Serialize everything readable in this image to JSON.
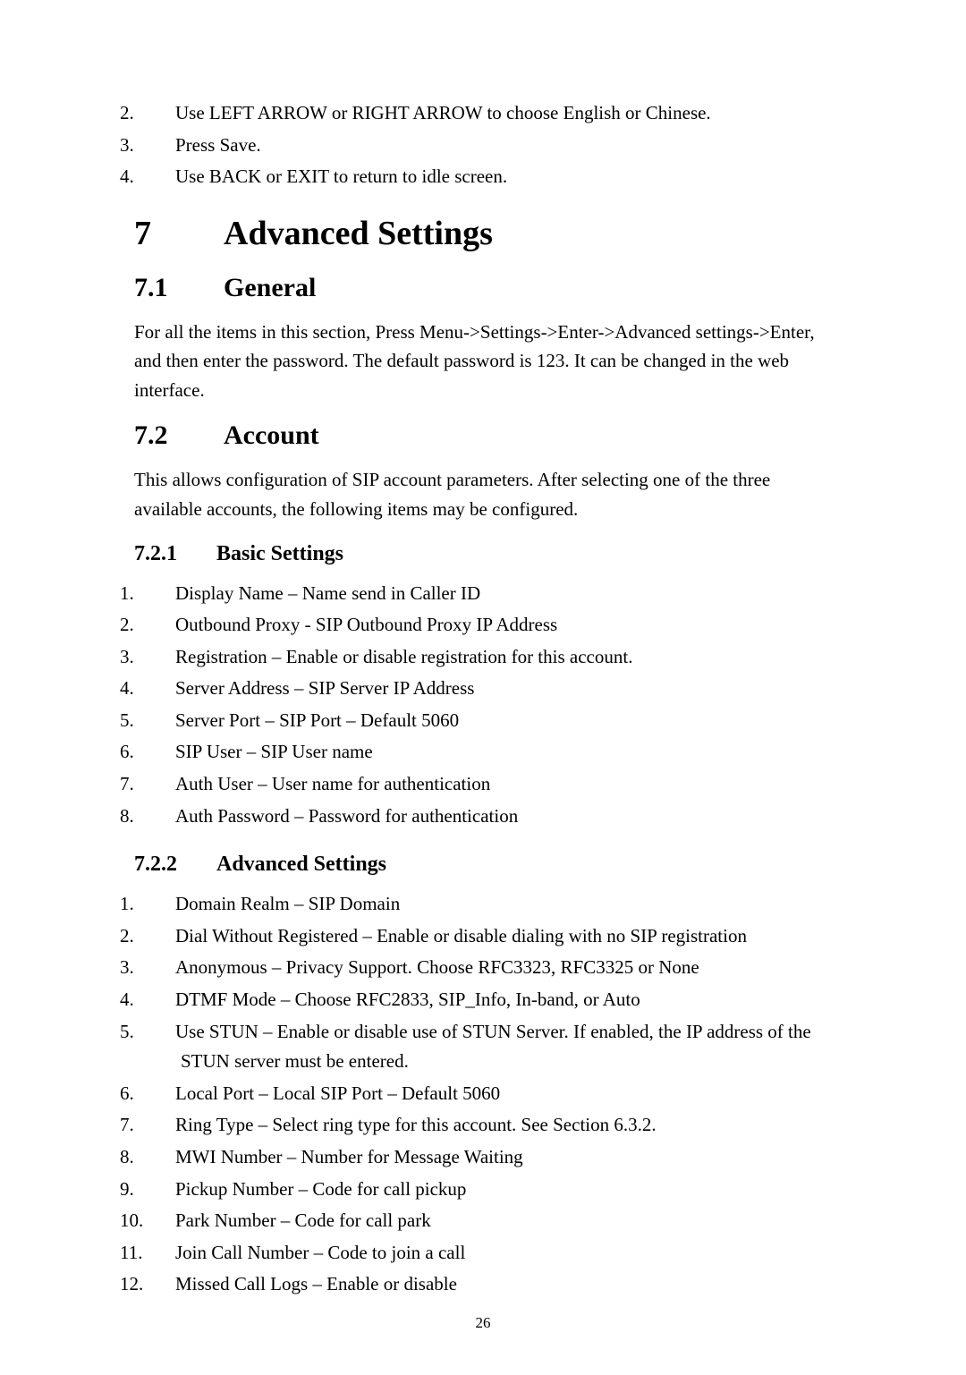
{
  "top_list": {
    "items": [
      {
        "n": "2.",
        "t": "Use LEFT ARROW or RIGHT ARROW to choose English or Chinese."
      },
      {
        "n": "3.",
        "t": "Press Save."
      },
      {
        "n": "4.",
        "t": "Use BACK or EXIT to return to idle screen."
      }
    ]
  },
  "h1": {
    "n": "7",
    "t": "Advanced Settings"
  },
  "s71": {
    "h2": {
      "n": "7.1",
      "t": "General"
    },
    "p": "For all the items in this section, Press Menu->Settings->Enter->Advanced settings->Enter, and then enter the password.    The default password is 123. It can be changed in the web interface."
  },
  "s72": {
    "h2": {
      "n": "7.2",
      "t": "Account"
    },
    "p": "This allows configuration of SIP account parameters.    After selecting one of the three available accounts, the following items may be configured."
  },
  "s721": {
    "h3": {
      "n": "7.2.1",
      "t": "Basic Settings"
    },
    "items": [
      {
        "n": "1.",
        "t": "Display Name – Name send in Caller ID"
      },
      {
        "n": "2.",
        "t": "Outbound Proxy - SIP Outbound Proxy IP Address"
      },
      {
        "n": "3.",
        "t": "Registration – Enable or disable registration for this account."
      },
      {
        "n": "4.",
        "t": "Server Address – SIP Server IP Address"
      },
      {
        "n": "5.",
        "t": "Server Port – SIP Port – Default 5060"
      },
      {
        "n": "6.",
        "t": "SIP User – SIP User name"
      },
      {
        "n": "7.",
        "t": "Auth User – User name for authentication"
      },
      {
        "n": "8.",
        "t": "Auth Password – Password for authentication"
      }
    ]
  },
  "s722": {
    "h3": {
      "n": "7.2.2",
      "t": "Advanced Settings"
    },
    "items": [
      {
        "n": "1.",
        "t": "Domain Realm – SIP Domain"
      },
      {
        "n": "2.",
        "t": "Dial Without Registered – Enable or disable dialing with no SIP registration"
      },
      {
        "n": "3.",
        "t": "Anonymous – Privacy Support. Choose RFC3323, RFC3325 or None"
      },
      {
        "n": "4.",
        "t": "DTMF Mode – Choose RFC2833, SIP_Info, In-band, or Auto"
      },
      {
        "n": "5.",
        "t": "Use STUN – Enable or disable use of STUN Server.   If enabled, the IP address of the STUN server must be entered."
      },
      {
        "n": "6.",
        "t": "Local Port – Local SIP Port – Default 5060"
      },
      {
        "n": "7.",
        "t": "Ring Type – Select ring type for this account. See Section 6.3.2."
      },
      {
        "n": "8.",
        "t": "MWI Number – Number for Message Waiting"
      },
      {
        "n": "9.",
        "t": "Pickup Number – Code for call pickup"
      },
      {
        "n": "10.",
        "t": "Park Number – Code for call park"
      },
      {
        "n": "11.",
        "t": "Join Call Number – Code to join a call"
      },
      {
        "n": "12.",
        "t": "Missed Call Logs – Enable or disable"
      }
    ]
  },
  "page_number": "26"
}
